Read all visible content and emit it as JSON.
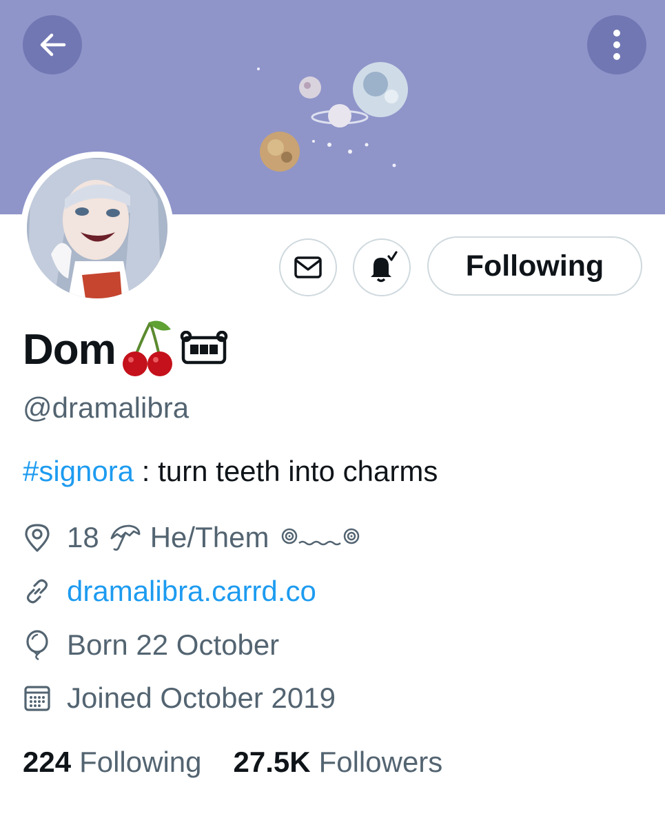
{
  "header": {
    "back_icon": "arrow-left-icon",
    "more_icon": "more-vertical-icon"
  },
  "actions": {
    "message_icon": "envelope-icon",
    "notify_icon": "bell-check-icon",
    "follow_label": "Following"
  },
  "profile": {
    "name": "Dom",
    "name_emojis": [
      "cherries",
      "robot-face"
    ],
    "handle": "@dramalibra",
    "bio_hashtag": "#signora",
    "bio_text": " : turn teeth into charms",
    "details_text": "18",
    "details_text2": "He/Them",
    "link": "dramalibra.carrd.co",
    "birthday": "Born 22 October",
    "joined": "Joined October 2019"
  },
  "stats": {
    "following_count": "224",
    "following_label": "Following",
    "followers_count": "27.5K",
    "followers_label": "Followers"
  },
  "colors": {
    "banner": "#8f95c9",
    "accent": "#1d9bf0",
    "secondary_text": "#536471"
  }
}
